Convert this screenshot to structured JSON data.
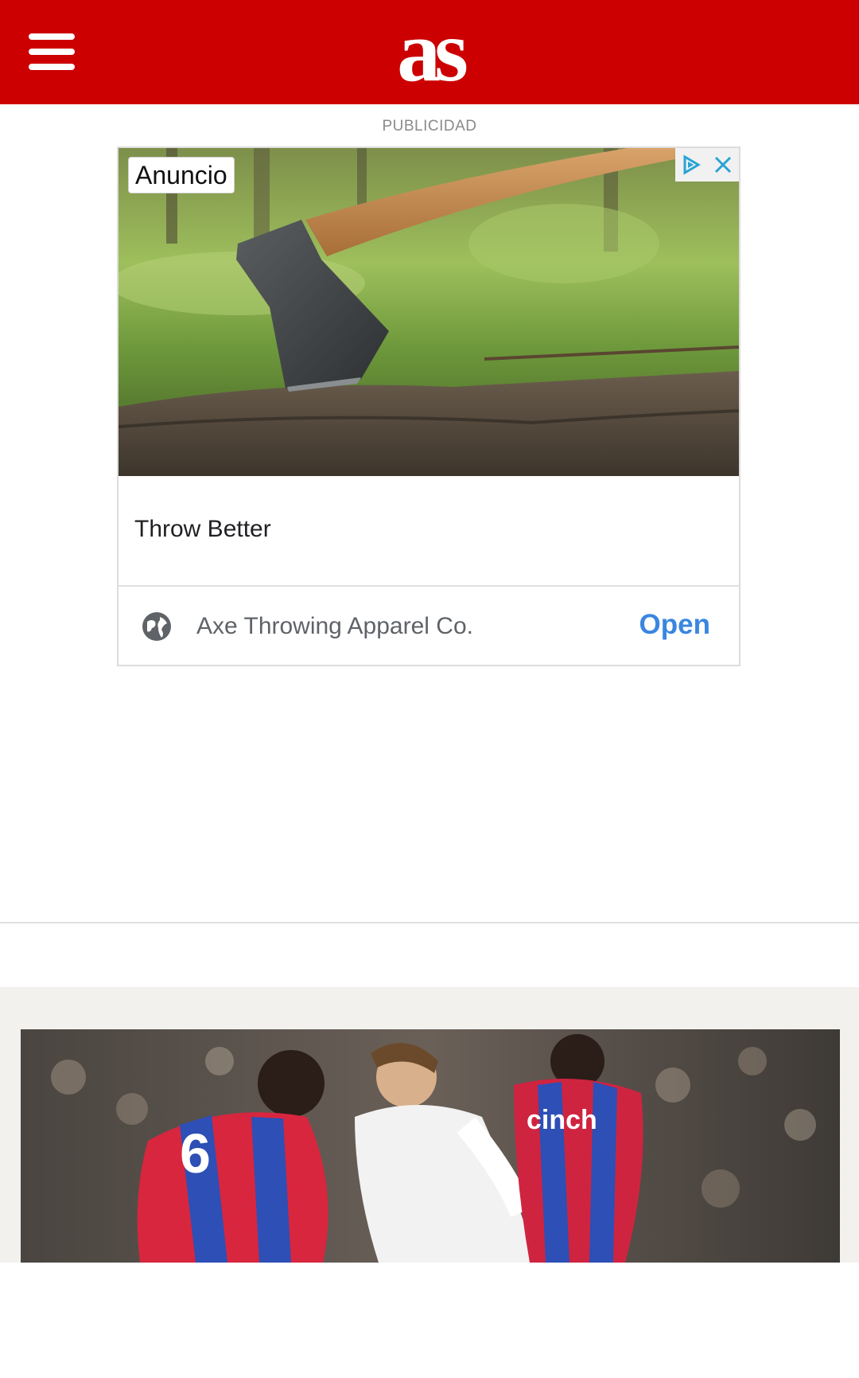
{
  "header": {
    "logo_text": "as",
    "menu_icon": "hamburger-menu-icon",
    "brand_color": "#cc0000"
  },
  "ad": {
    "section_label": "PUBLICIDAD",
    "badge": "Anuncio",
    "choices_icon": "adchoices-icon",
    "close_icon": "close-icon",
    "headline": "Throw Better",
    "advertiser": "Axe Throwing Apparel Co.",
    "advertiser_icon": "globe-icon",
    "cta": "Open",
    "cta_color": "#3a86e0"
  },
  "article": {
    "image": "football-match-photo"
  }
}
